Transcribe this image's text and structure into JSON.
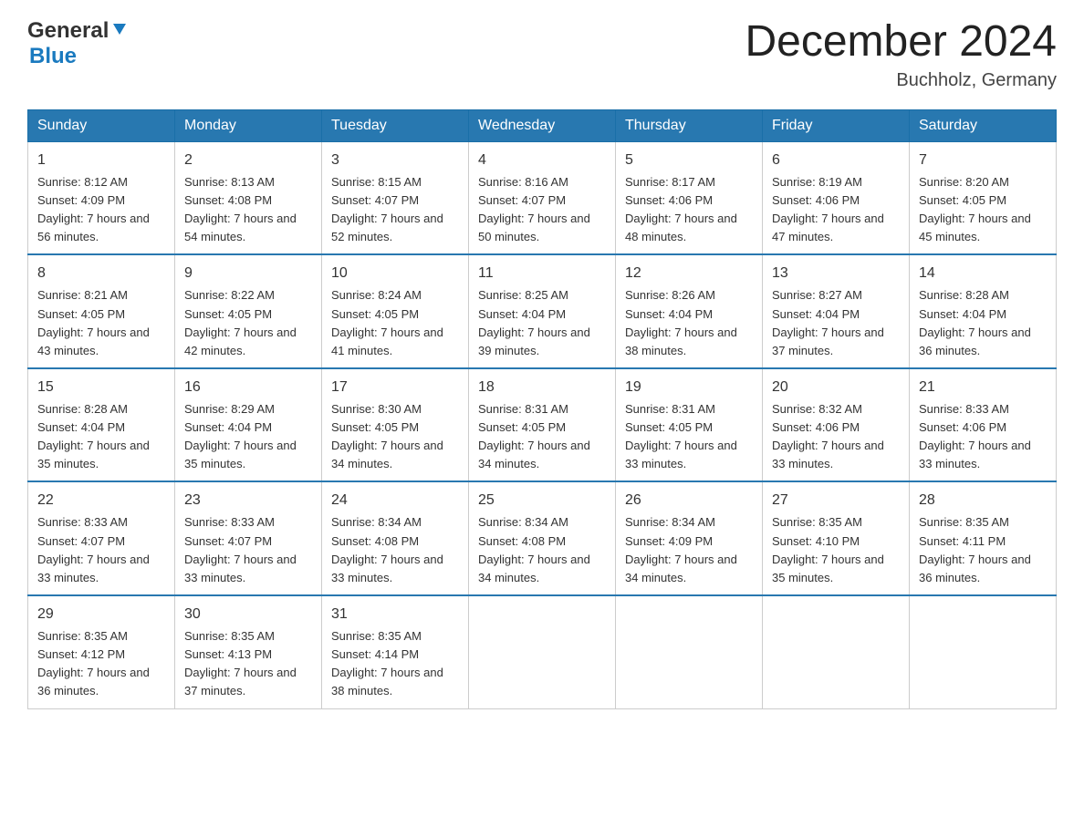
{
  "logo": {
    "text_general": "General",
    "text_blue": "Blue"
  },
  "title": {
    "month_year": "December 2024",
    "location": "Buchholz, Germany"
  },
  "calendar": {
    "headers": [
      "Sunday",
      "Monday",
      "Tuesday",
      "Wednesday",
      "Thursday",
      "Friday",
      "Saturday"
    ],
    "weeks": [
      [
        {
          "day": "1",
          "sunrise": "8:12 AM",
          "sunset": "4:09 PM",
          "daylight": "7 hours and 56 minutes."
        },
        {
          "day": "2",
          "sunrise": "8:13 AM",
          "sunset": "4:08 PM",
          "daylight": "7 hours and 54 minutes."
        },
        {
          "day": "3",
          "sunrise": "8:15 AM",
          "sunset": "4:07 PM",
          "daylight": "7 hours and 52 minutes."
        },
        {
          "day": "4",
          "sunrise": "8:16 AM",
          "sunset": "4:07 PM",
          "daylight": "7 hours and 50 minutes."
        },
        {
          "day": "5",
          "sunrise": "8:17 AM",
          "sunset": "4:06 PM",
          "daylight": "7 hours and 48 minutes."
        },
        {
          "day": "6",
          "sunrise": "8:19 AM",
          "sunset": "4:06 PM",
          "daylight": "7 hours and 47 minutes."
        },
        {
          "day": "7",
          "sunrise": "8:20 AM",
          "sunset": "4:05 PM",
          "daylight": "7 hours and 45 minutes."
        }
      ],
      [
        {
          "day": "8",
          "sunrise": "8:21 AM",
          "sunset": "4:05 PM",
          "daylight": "7 hours and 43 minutes."
        },
        {
          "day": "9",
          "sunrise": "8:22 AM",
          "sunset": "4:05 PM",
          "daylight": "7 hours and 42 minutes."
        },
        {
          "day": "10",
          "sunrise": "8:24 AM",
          "sunset": "4:05 PM",
          "daylight": "7 hours and 41 minutes."
        },
        {
          "day": "11",
          "sunrise": "8:25 AM",
          "sunset": "4:04 PM",
          "daylight": "7 hours and 39 minutes."
        },
        {
          "day": "12",
          "sunrise": "8:26 AM",
          "sunset": "4:04 PM",
          "daylight": "7 hours and 38 minutes."
        },
        {
          "day": "13",
          "sunrise": "8:27 AM",
          "sunset": "4:04 PM",
          "daylight": "7 hours and 37 minutes."
        },
        {
          "day": "14",
          "sunrise": "8:28 AM",
          "sunset": "4:04 PM",
          "daylight": "7 hours and 36 minutes."
        }
      ],
      [
        {
          "day": "15",
          "sunrise": "8:28 AM",
          "sunset": "4:04 PM",
          "daylight": "7 hours and 35 minutes."
        },
        {
          "day": "16",
          "sunrise": "8:29 AM",
          "sunset": "4:04 PM",
          "daylight": "7 hours and 35 minutes."
        },
        {
          "day": "17",
          "sunrise": "8:30 AM",
          "sunset": "4:05 PM",
          "daylight": "7 hours and 34 minutes."
        },
        {
          "day": "18",
          "sunrise": "8:31 AM",
          "sunset": "4:05 PM",
          "daylight": "7 hours and 34 minutes."
        },
        {
          "day": "19",
          "sunrise": "8:31 AM",
          "sunset": "4:05 PM",
          "daylight": "7 hours and 33 minutes."
        },
        {
          "day": "20",
          "sunrise": "8:32 AM",
          "sunset": "4:06 PM",
          "daylight": "7 hours and 33 minutes."
        },
        {
          "day": "21",
          "sunrise": "8:33 AM",
          "sunset": "4:06 PM",
          "daylight": "7 hours and 33 minutes."
        }
      ],
      [
        {
          "day": "22",
          "sunrise": "8:33 AM",
          "sunset": "4:07 PM",
          "daylight": "7 hours and 33 minutes."
        },
        {
          "day": "23",
          "sunrise": "8:33 AM",
          "sunset": "4:07 PM",
          "daylight": "7 hours and 33 minutes."
        },
        {
          "day": "24",
          "sunrise": "8:34 AM",
          "sunset": "4:08 PM",
          "daylight": "7 hours and 33 minutes."
        },
        {
          "day": "25",
          "sunrise": "8:34 AM",
          "sunset": "4:08 PM",
          "daylight": "7 hours and 34 minutes."
        },
        {
          "day": "26",
          "sunrise": "8:34 AM",
          "sunset": "4:09 PM",
          "daylight": "7 hours and 34 minutes."
        },
        {
          "day": "27",
          "sunrise": "8:35 AM",
          "sunset": "4:10 PM",
          "daylight": "7 hours and 35 minutes."
        },
        {
          "day": "28",
          "sunrise": "8:35 AM",
          "sunset": "4:11 PM",
          "daylight": "7 hours and 36 minutes."
        }
      ],
      [
        {
          "day": "29",
          "sunrise": "8:35 AM",
          "sunset": "4:12 PM",
          "daylight": "7 hours and 36 minutes."
        },
        {
          "day": "30",
          "sunrise": "8:35 AM",
          "sunset": "4:13 PM",
          "daylight": "7 hours and 37 minutes."
        },
        {
          "day": "31",
          "sunrise": "8:35 AM",
          "sunset": "4:14 PM",
          "daylight": "7 hours and 38 minutes."
        },
        null,
        null,
        null,
        null
      ]
    ]
  }
}
